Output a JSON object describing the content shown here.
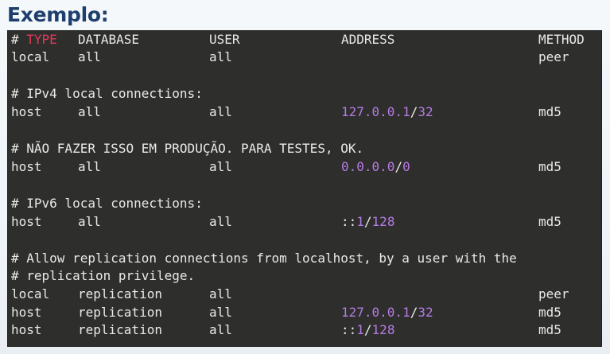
{
  "slide": {
    "title": "Exemplo:"
  },
  "colors": {
    "terminal_bg": "#2e2e2d",
    "text": "#e9e9e6",
    "keyword_highlight": "#e33a5a",
    "number_highlight": "#b67be3",
    "title": "#1e3f6d"
  },
  "terminal": {
    "header": {
      "hash": "#",
      "type": "TYPE",
      "database": "DATABASE",
      "user": "USER",
      "address": "ADDRESS",
      "method": "METHOD"
    },
    "row_local_peer": {
      "type": "local",
      "database": "all",
      "user": "all",
      "method": "peer"
    },
    "comment_ipv4": "# IPv4 local connections:",
    "row_ipv4": {
      "type": "host",
      "database": "all",
      "user": "all",
      "address_ip": "127.0.0.1",
      "address_sep": "/",
      "address_mask": "32",
      "method": "md5"
    },
    "comment_nao_fazer": "# NÃO FAZER ISSO EM PRODUÇÃO. PARA TESTES, OK.",
    "row_open": {
      "type": "host",
      "database": "all",
      "user": "all",
      "address_ip": "0.0.0.0",
      "address_sep": "/",
      "address_mask": "0",
      "method": "md5"
    },
    "comment_ipv6": "# IPv6 local connections:",
    "row_ipv6": {
      "type": "host",
      "database": "all",
      "user": "all",
      "address_prefix": "::",
      "address_ip": "1",
      "address_sep": "/",
      "address_mask": "128",
      "method": "md5"
    },
    "comment_replication_1": "# Allow replication connections from localhost, by a user with the",
    "comment_replication_2": "# replication privilege.",
    "row_repl_local": {
      "type": "local",
      "database": "replication",
      "user": "all",
      "method": "peer"
    },
    "row_repl_ipv4": {
      "type": "host",
      "database": "replication",
      "user": "all",
      "address_ip": "127.0.0.1",
      "address_sep": "/",
      "address_mask": "32",
      "method": "md5"
    },
    "row_repl_ipv6": {
      "type": "host",
      "database": "replication",
      "user": "all",
      "address_prefix": "::",
      "address_ip": "1",
      "address_sep": "/",
      "address_mask": "128",
      "method": "md5"
    }
  }
}
